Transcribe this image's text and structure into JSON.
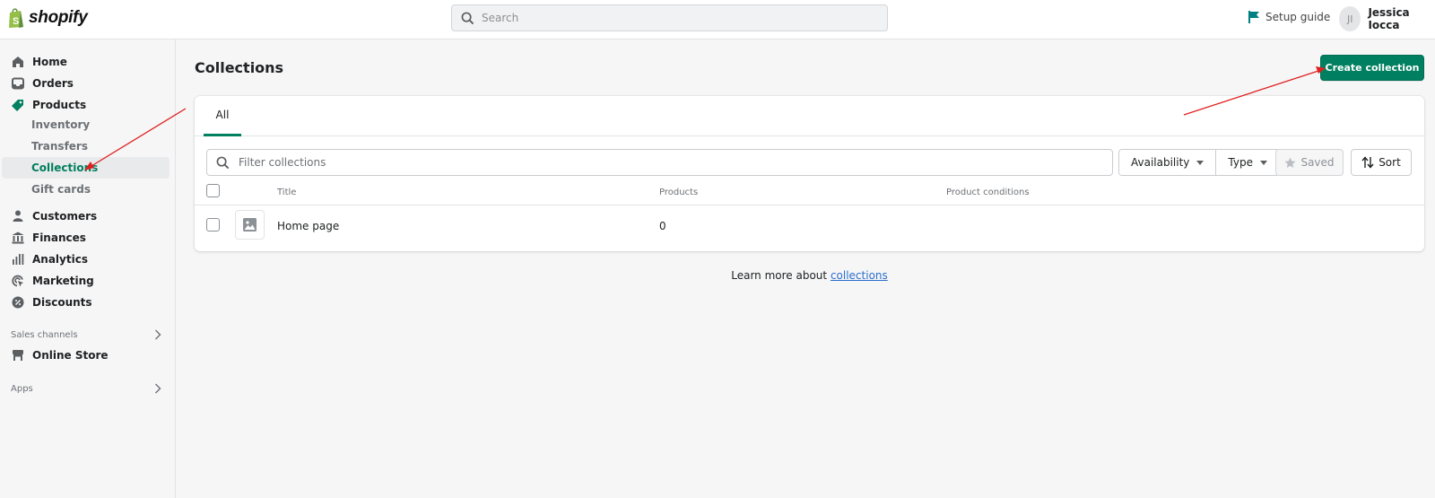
{
  "topbar": {
    "brand": "shopify",
    "search_placeholder": "Search",
    "setup_guide": "Setup guide",
    "user_initials": "JI",
    "user_name": "Jessica Iocca"
  },
  "sidebar": {
    "items": [
      {
        "label": "Home",
        "icon": "home-icon"
      },
      {
        "label": "Orders",
        "icon": "inbox-icon"
      },
      {
        "label": "Products",
        "icon": "tag-icon"
      }
    ],
    "product_subitems": [
      {
        "label": "Inventory"
      },
      {
        "label": "Transfers"
      },
      {
        "label": "Collections",
        "active": true
      },
      {
        "label": "Gift cards"
      }
    ],
    "items2": [
      {
        "label": "Customers",
        "icon": "person-icon"
      },
      {
        "label": "Finances",
        "icon": "bank-icon"
      },
      {
        "label": "Analytics",
        "icon": "bar-chart-icon"
      },
      {
        "label": "Marketing",
        "icon": "target-icon"
      },
      {
        "label": "Discounts",
        "icon": "discount-icon"
      }
    ],
    "sales_channels_label": "Sales channels",
    "online_store": "Online Store",
    "apps_label": "Apps"
  },
  "main": {
    "title": "Collections",
    "create_button": "Create collection",
    "tabs": [
      {
        "label": "All",
        "active": true
      }
    ],
    "filter_placeholder": "Filter collections",
    "filters": {
      "availability": "Availability",
      "type": "Type",
      "saved": "Saved",
      "sort": "Sort"
    },
    "table": {
      "columns": [
        "Title",
        "Products",
        "Product conditions"
      ],
      "rows": [
        {
          "title": "Home page",
          "products": "0",
          "conditions": ""
        }
      ]
    },
    "learn_more_prefix": "Learn more about ",
    "learn_more_link": "collections"
  },
  "colors": {
    "brand_green": "#008060",
    "annotation_arrow": "#e02020",
    "link": "#2c6ecb"
  }
}
